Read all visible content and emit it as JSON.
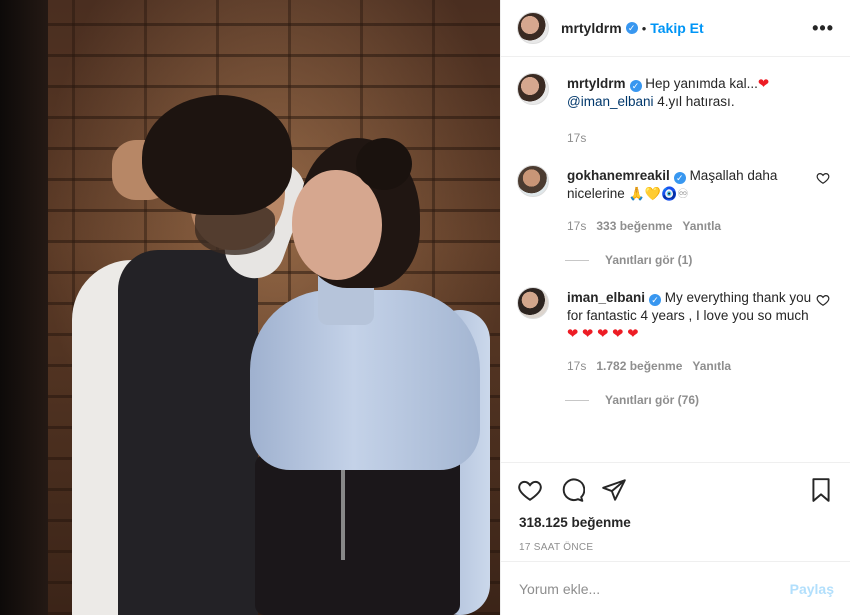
{
  "post": {
    "username": "mrtyldrm",
    "follow_label": "Takip Et",
    "dot": "•",
    "more_label": "•••"
  },
  "caption": {
    "username": "mrtyldrm",
    "text": "Hep yanımda kal...",
    "mention": "@iman_elbani",
    "text2": "4.yıl hatırası.",
    "time": "17s"
  },
  "comments": [
    {
      "username": "gokhanemreakil",
      "text": "Maşallah daha nicelerine",
      "time": "17s",
      "likes": "333 beğenme",
      "reply_label": "Yanıtla",
      "view_replies": "Yanıtları gör (1)"
    },
    {
      "username": "iman_elbani",
      "text": "My everything thank you for fantastic 4 years , I love you so much",
      "time": "17s",
      "likes": "1.782 beğenme",
      "reply_label": "Yanıtla",
      "view_replies": "Yanıtları gör (76)"
    }
  ],
  "footer": {
    "likes": "318.125 beğenme",
    "timestamp": "17 SAAT ÖNCE",
    "comment_placeholder": "Yorum ekle...",
    "post_label": "Paylaş"
  },
  "colors": {
    "link_blue": "#0095f6",
    "verified_blue": "#3897f0",
    "muted_text": "#8e8e8e"
  },
  "icons": {
    "like": "heart-icon",
    "comment": "comment-icon",
    "share": "share-icon",
    "save": "bookmark-icon",
    "verified": "verified-badge-icon"
  }
}
